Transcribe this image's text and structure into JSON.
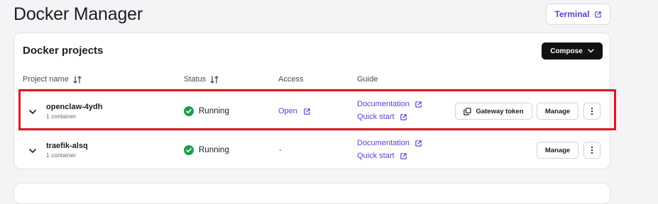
{
  "page": {
    "title": "Docker Manager",
    "terminal_label": "Terminal"
  },
  "card": {
    "title": "Docker projects",
    "compose_label": "Compose",
    "columns": {
      "project": "Project name",
      "status": "Status",
      "access": "Access",
      "guide": "Guide"
    }
  },
  "rows": [
    {
      "name": "openclaw-4ydh",
      "sub": "1 container",
      "status": "Running",
      "access": "Open",
      "guide_doc": "Documentation",
      "guide_quick": "Quick start",
      "gateway_label": "Gateway token",
      "manage_label": "Manage"
    },
    {
      "name": "traefik-alsq",
      "sub": "1 container",
      "status": "Running",
      "access": "-",
      "guide_doc": "Documentation",
      "guide_quick": "Quick start",
      "manage_label": "Manage"
    }
  ],
  "colors": {
    "accent": "#5b3fd6",
    "running": "#1f9d4c",
    "highlight": "#e3141b"
  }
}
